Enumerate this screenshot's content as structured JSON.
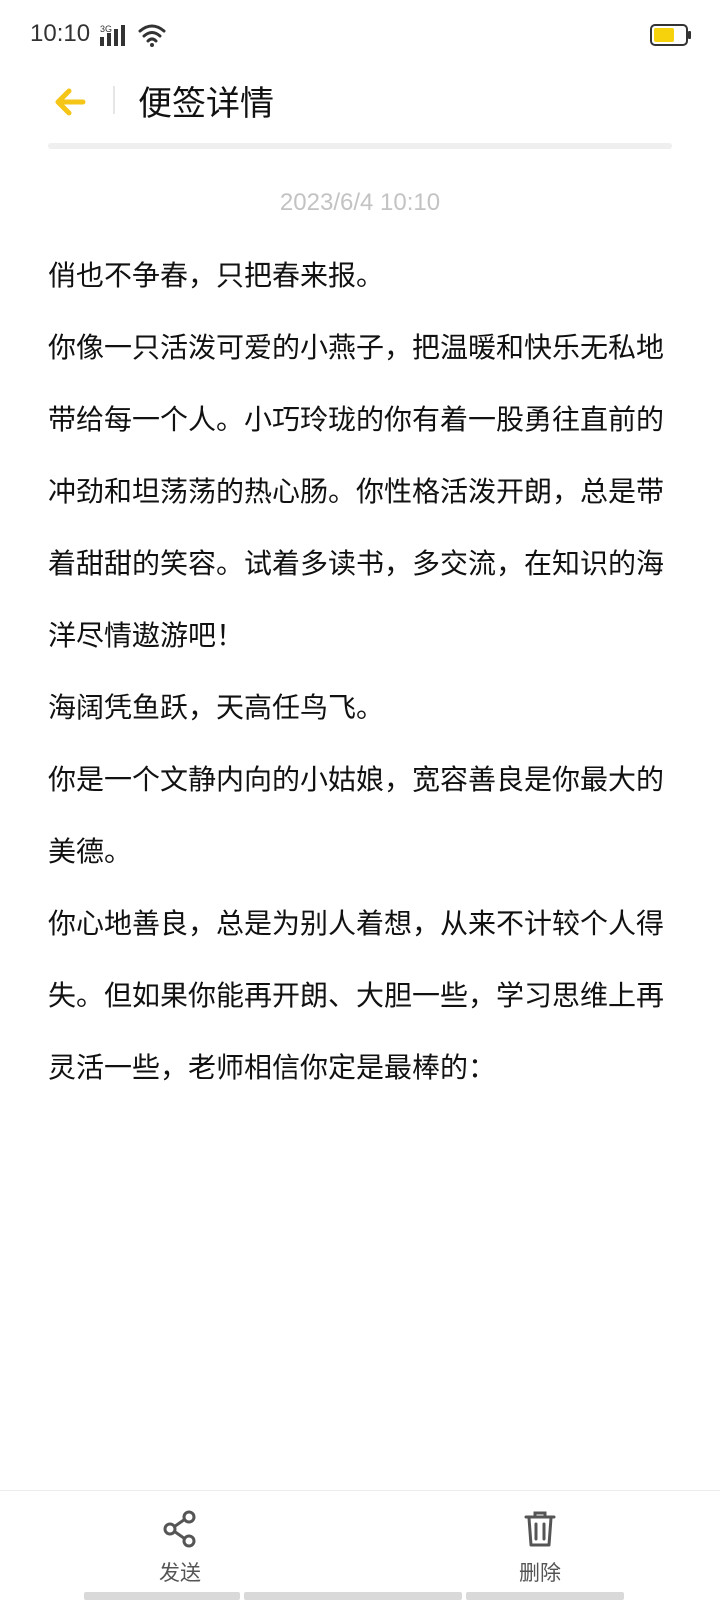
{
  "status_bar": {
    "time": "10:10",
    "network": "3G",
    "icons": [
      "signal-icon",
      "wifi-icon",
      "battery-icon"
    ]
  },
  "header": {
    "title": "便签详情",
    "back_icon": "arrow-left-icon",
    "accent_color": "#f5c518"
  },
  "note": {
    "timestamp": "2023/6/4 10:10",
    "paragraphs": [
      "俏也不争春，只把春来报。",
      "你像一只活泼可爱的小燕子，把温暖和快乐无私地带给每一个人。小巧玲珑的你有着一股勇往直前的冲劲和坦荡荡的热心肠。你性格活泼开朗，总是带着甜甜的笑容。试着多读书，多交流，在知识的海洋尽情遨游吧！",
      "海阔凭鱼跃，天高任鸟飞。",
      "你是一个文静内向的小姑娘，宽容善良是你最大的美德。",
      "你心地善良，总是为别人着想，从来不计较个人得失。但如果你能再开朗、大胆一些，学习思维上再灵活一些，老师相信你定是最棒的："
    ]
  },
  "bottom_bar": {
    "send_label": "发送",
    "send_icon": "share-icon",
    "delete_label": "删除",
    "delete_icon": "trash-icon"
  }
}
